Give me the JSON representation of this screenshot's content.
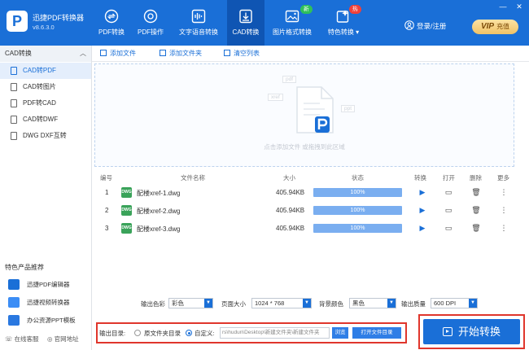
{
  "app": {
    "name": "迅捷PDF转换器",
    "version": "v8.6.3.0",
    "logo_letter": "P"
  },
  "nav": [
    {
      "label": "PDF转换"
    },
    {
      "label": "PDF操作"
    },
    {
      "label": "文字语音转换"
    },
    {
      "label": "CAD转换"
    },
    {
      "label": "图片格式转换",
      "badge": "新"
    },
    {
      "label": "特色转换 ▾",
      "badge": "热"
    }
  ],
  "window": {
    "minimize": "—",
    "close": "✕"
  },
  "account": {
    "login": "登录/注册",
    "vip_brand": "VIP",
    "vip_label": "充值"
  },
  "sidebar": {
    "section_title": "CAD转换",
    "items": [
      {
        "label": "CAD转PDF"
      },
      {
        "label": "CAD转图片"
      },
      {
        "label": "PDF转CAD"
      },
      {
        "label": "CAD转DWF"
      },
      {
        "label": "DWG DXF互转"
      }
    ],
    "featured_title": "特色产品推荐",
    "featured": [
      {
        "label": "迅捷PDF编辑器"
      },
      {
        "label": "迅捷视频转换器"
      },
      {
        "label": "办公资源PPT模板"
      }
    ],
    "footer": {
      "service": "在线客服",
      "website": "官网地址"
    }
  },
  "toolbar": {
    "add_file": "添加文件",
    "add_folder": "添加文件夹",
    "clear_list": "清空列表"
  },
  "dropzone": {
    "hint": "点击添加文件 或拖拽到此区域",
    "tags": [
      "pdf",
      "xref",
      "ppt"
    ]
  },
  "table": {
    "headers": {
      "index": "编号",
      "name": "文件名称",
      "size": "大小",
      "status": "状态",
      "convert": "转换",
      "open": "打开",
      "delete": "删除",
      "more": "更多"
    },
    "rows": [
      {
        "index": "1",
        "icon": "DWG",
        "name": "配楼xref-1.dwg",
        "size": "405.94KB",
        "status": "100%",
        "progress": 1.0
      },
      {
        "index": "2",
        "icon": "DWG",
        "name": "配楼xref-2.dwg",
        "size": "405.94KB",
        "status": "100%",
        "progress": 1.0
      },
      {
        "index": "3",
        "icon": "DWG",
        "name": "配楼xref-3.dwg",
        "size": "405.94KB",
        "status": "100%",
        "progress": 1.0
      }
    ]
  },
  "params": {
    "color_label": "输出色彩",
    "color_value": "彩色",
    "page_label": "页面大小",
    "page_value": "1024 * 768",
    "bg_label": "背景颜色",
    "bg_value": "黑色",
    "quality_label": "输出质量",
    "quality_value": "600 DPI"
  },
  "output": {
    "label": "输出目录:",
    "opt_original": "原文件夹目录",
    "opt_custom": "自定义:",
    "path": "rs\\hudun\\Desktop\\新建文件夹\\新建文件夹",
    "browse": "浏览",
    "open_dir": "打开文件目录"
  },
  "start_button": "开始转换",
  "colors": {
    "primary": "#1a6fd7",
    "highlight_border": "#e0362c",
    "progress": "#7aaef0"
  }
}
